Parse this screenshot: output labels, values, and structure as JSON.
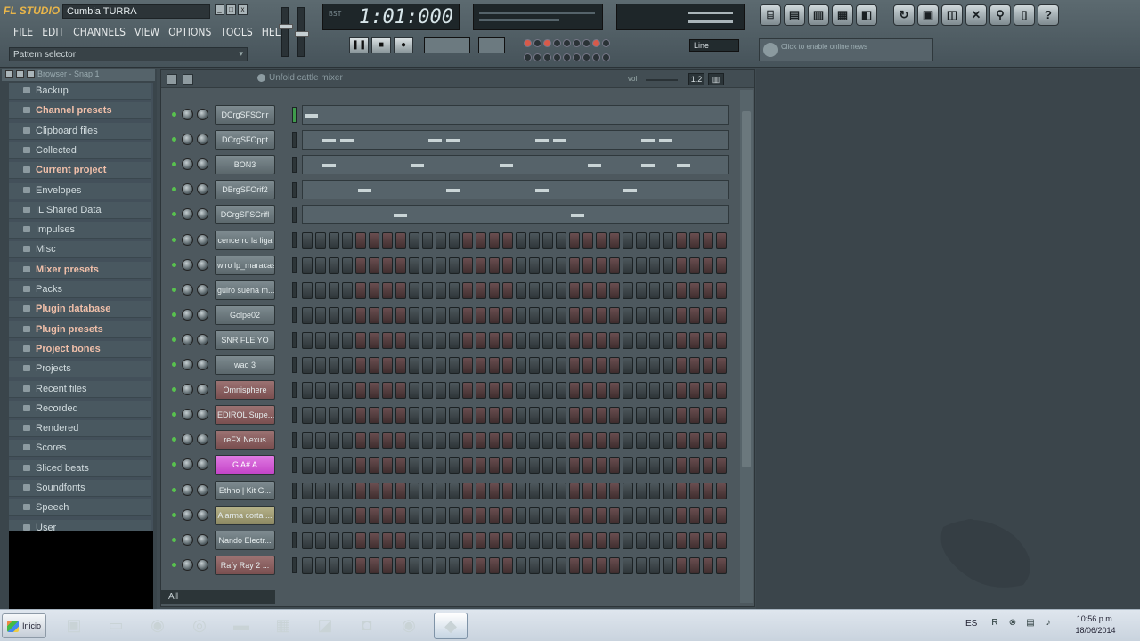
{
  "app": {
    "logo_text": "FL STUDIO",
    "song_title": "Cumbia TURRA"
  },
  "window_buttons": [
    "_",
    "□",
    "x"
  ],
  "menu": [
    "FILE",
    "EDIT",
    "CHANNELS",
    "VIEW",
    "OPTIONS",
    "TOOLS",
    "HELP"
  ],
  "pattern_selector": {
    "label": "Pattern selector",
    "arrow": "▾"
  },
  "transport": {
    "time": "1:01:000",
    "pause_icon": "pause-icon",
    "stop_icon": "stop-icon",
    "record_icon": "record-icon",
    "line_mode": "Line"
  },
  "toolbar_icons": [
    "channels-icon",
    "mixer-icon",
    "piano-roll-icon",
    "playlist-icon",
    "plugin-icon",
    "history-icon",
    "open-icon",
    "save-icon",
    "close-icon",
    "search-icon",
    "file-icon",
    "help-icon"
  ],
  "toolbar_glyphs": [
    "⌸",
    "▤",
    "▥",
    "▦",
    "◧",
    "↻",
    "▣",
    "◫",
    "✕",
    "⚲",
    "▯",
    "?"
  ],
  "online_news_hint": "Click to enable online news",
  "browser": {
    "header": "Browser - Snap 1",
    "items": [
      {
        "label": "Backup",
        "highlight": false
      },
      {
        "label": "Channel presets",
        "highlight": true
      },
      {
        "label": "Clipboard files",
        "highlight": false
      },
      {
        "label": "Collected",
        "highlight": false
      },
      {
        "label": "Current project",
        "highlight": true
      },
      {
        "label": "Envelopes",
        "highlight": false
      },
      {
        "label": "IL Shared Data",
        "highlight": false
      },
      {
        "label": "Impulses",
        "highlight": false
      },
      {
        "label": "Misc",
        "highlight": false
      },
      {
        "label": "Mixer presets",
        "highlight": true
      },
      {
        "label": "Packs",
        "highlight": false
      },
      {
        "label": "Plugin database",
        "highlight": true
      },
      {
        "label": "Plugin presets",
        "highlight": true
      },
      {
        "label": "Project bones",
        "highlight": true
      },
      {
        "label": "Projects",
        "highlight": false
      },
      {
        "label": "Recent files",
        "highlight": false
      },
      {
        "label": "Recorded",
        "highlight": false
      },
      {
        "label": "Rendered",
        "highlight": false
      },
      {
        "label": "Scores",
        "highlight": false
      },
      {
        "label": "Sliced beats",
        "highlight": false
      },
      {
        "label": "Soundfonts",
        "highlight": false
      },
      {
        "label": "Speech",
        "highlight": false
      },
      {
        "label": "User",
        "highlight": false
      }
    ]
  },
  "channel_rack": {
    "title": "Unfold cattle mixer",
    "volume_label": "vol",
    "view_buttons": [
      "1.2",
      "▥"
    ],
    "filter": "All",
    "channels": [
      {
        "name": "DCrgSFSCrir",
        "style": "gray",
        "type": "piano",
        "selected": true
      },
      {
        "name": "DCrgSFOppt",
        "style": "gray",
        "type": "piano",
        "selected": false
      },
      {
        "name": "BON3",
        "style": "gray",
        "type": "piano",
        "selected": false
      },
      {
        "name": "DBrgSFOrif2",
        "style": "gray",
        "type": "piano",
        "selected": false
      },
      {
        "name": "DCrgSFSCrifl",
        "style": "gray",
        "type": "piano",
        "selected": false
      },
      {
        "name": "cencerro la liga",
        "style": "gray",
        "type": "steps",
        "selected": false
      },
      {
        "name": "wiro lp_maracas",
        "style": "gray",
        "type": "steps",
        "selected": false
      },
      {
        "name": "guiro suena m...",
        "style": "gray",
        "type": "steps",
        "selected": false
      },
      {
        "name": "Golpe02",
        "style": "gray",
        "type": "steps",
        "selected": false
      },
      {
        "name": "SNR FLE YO",
        "style": "gray",
        "type": "steps",
        "selected": false
      },
      {
        "name": "wao 3",
        "style": "gray",
        "type": "steps",
        "selected": false
      },
      {
        "name": "Omnisphere",
        "style": "red",
        "type": "steps",
        "selected": false
      },
      {
        "name": "EDIROL Supe...",
        "style": "red",
        "type": "steps",
        "selected": false
      },
      {
        "name": "reFX Nexus",
        "style": "red",
        "type": "steps",
        "selected": false
      },
      {
        "name": "G A# A",
        "style": "pink",
        "type": "steps",
        "selected": false
      },
      {
        "name": "Ethno | Kit G...",
        "style": "gray",
        "type": "steps",
        "selected": false
      },
      {
        "name": "Alarma corta ...",
        "style": "olive",
        "type": "steps",
        "selected": false
      },
      {
        "name": "Nando Electr...",
        "style": "gray",
        "type": "steps",
        "selected": false
      },
      {
        "name": "Rafy Ray 2 ...",
        "style": "red",
        "type": "steps",
        "selected": false
      }
    ],
    "piano_notes": [
      [
        0
      ],
      [
        1,
        2,
        7,
        8,
        13,
        14,
        19,
        20
      ],
      [
        1,
        6,
        11,
        16,
        19,
        21
      ],
      [
        3,
        8,
        13,
        18
      ],
      [
        5,
        15
      ]
    ]
  },
  "taskbar": {
    "start_label": "Inicio",
    "apps": [
      "excel-icon",
      "folder-icon",
      "chrome-icon",
      "firefox-icon",
      "terminal-icon",
      "network-icon",
      "files-icon",
      "camera-icon",
      "chrome-icon",
      "fl-studio-icon"
    ],
    "app_glyphs": [
      "▣",
      "▭",
      "◉",
      "◎",
      "▬",
      "▦",
      "◪",
      "◘",
      "◉",
      "◆"
    ],
    "language": "ES",
    "tray_glyphs": [
      "R",
      "⊗",
      "▤",
      "♪"
    ],
    "time": "10:56 p.m.",
    "date": "18/06/2014"
  }
}
